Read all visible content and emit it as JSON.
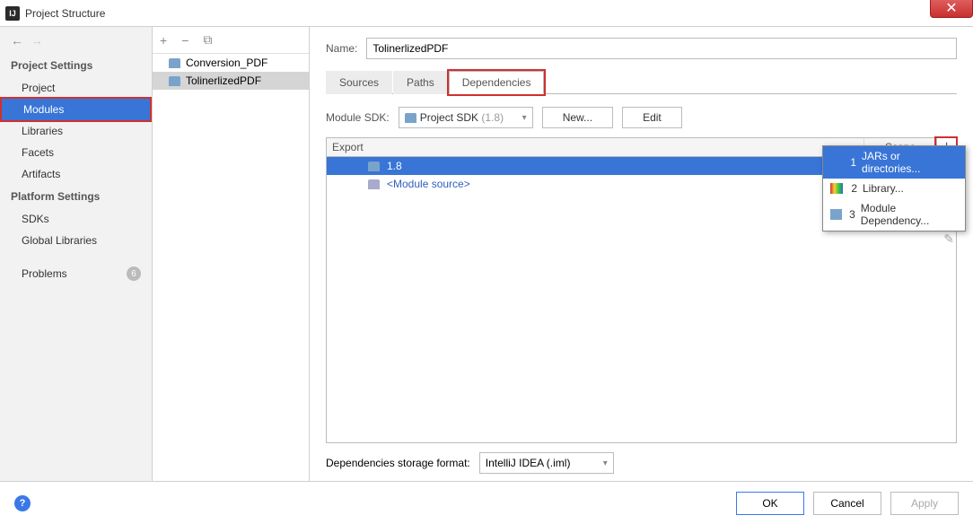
{
  "window": {
    "title": "Project Structure"
  },
  "sidebar": {
    "sections": {
      "project_settings": "Project Settings",
      "platform_settings": "Platform Settings"
    },
    "items": {
      "project": "Project",
      "modules": "Modules",
      "libraries": "Libraries",
      "facets": "Facets",
      "artifacts": "Artifacts",
      "sdks": "SDKs",
      "global_libraries": "Global Libraries",
      "problems": "Problems",
      "problems_count": "6"
    }
  },
  "modules": {
    "items": [
      {
        "name": "Conversion_PDF"
      },
      {
        "name": "TolinerlizedPDF"
      }
    ]
  },
  "content": {
    "name_label": "Name:",
    "name_value": "TolinerlizedPDF",
    "tabs": {
      "sources": "Sources",
      "paths": "Paths",
      "dependencies": "Dependencies"
    },
    "sdk": {
      "label": "Module SDK:",
      "selected": "Project SDK",
      "selected_suffix": "(1.8)",
      "new_btn": "New...",
      "edit_btn": "Edit"
    },
    "deps": {
      "col_export": "Export",
      "col_scope": "Scope",
      "row_18": "1.8",
      "row_module_source": "<Module source>"
    },
    "storage": {
      "label": "Dependencies storage format:",
      "value": "IntelliJ IDEA (.iml)"
    }
  },
  "popup": {
    "items": [
      {
        "num": "1",
        "label": "JARs or directories..."
      },
      {
        "num": "2",
        "label": "Library..."
      },
      {
        "num": "3",
        "label": "Module Dependency..."
      }
    ]
  },
  "footer": {
    "ok": "OK",
    "cancel": "Cancel",
    "apply": "Apply"
  }
}
